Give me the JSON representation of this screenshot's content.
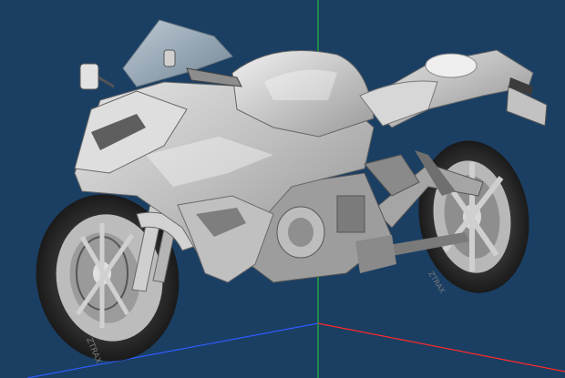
{
  "viewport": {
    "background_color": "#1b3f63",
    "model": {
      "render_style": "gray shaded",
      "body_color": "#c9c9c9",
      "shadow_color": "#6f6f6f",
      "tire_color": "#2b2b2b",
      "windscreen_color": "#a9b8c3",
      "brake_disc_color": "#9a9a9a",
      "chassis_color": "#5f5f5f"
    },
    "axes": {
      "vertical_axis_color": "#1fbe35",
      "depth_axis_color": "#2f5cff",
      "horizontal_axis_color": "#ff2a2a"
    },
    "tire_markings": [
      "ZTRAX",
      "ZTRAX"
    ]
  }
}
